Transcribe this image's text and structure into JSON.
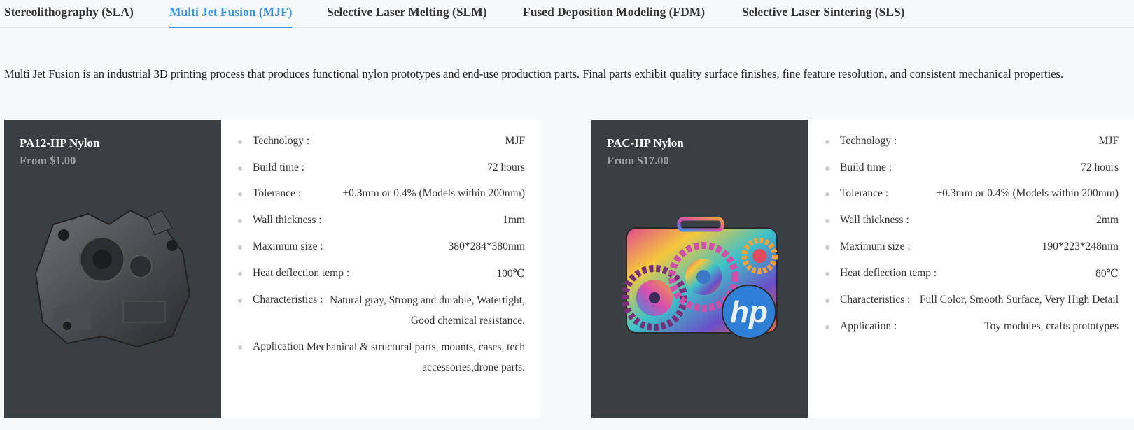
{
  "tabs": [
    {
      "label": "Stereolithography (SLA)",
      "active": false
    },
    {
      "label": "Multi Jet Fusion (MJF)",
      "active": true
    },
    {
      "label": "Selective Laser Melting (SLM)",
      "active": false
    },
    {
      "label": "Fused Deposition Modeling (FDM)",
      "active": false
    },
    {
      "label": "Selective Laser Sintering (SLS)",
      "active": false
    }
  ],
  "description": "Multi Jet Fusion is an industrial 3D printing process that produces functional nylon prototypes and end-use production parts. Final parts exhibit quality surface finishes, fine feature resolution, and consistent mechanical properties.",
  "materials": [
    {
      "name": "PA12-HP Nylon",
      "price": "From $1.00",
      "specs": [
        {
          "label": "Technology :",
          "value": "MJF"
        },
        {
          "label": "Build time :",
          "value": "72 hours"
        },
        {
          "label": "Tolerance :",
          "value": "±0.3mm or 0.4% (Models within 200mm)"
        },
        {
          "label": "Wall thickness :",
          "value": "1mm"
        },
        {
          "label": "Maximum size :",
          "value": "380*284*380mm"
        },
        {
          "label": "Heat deflection temp :",
          "value": "100℃"
        },
        {
          "label": "Characteristics :",
          "value": "Natural gray, Strong and durable, Watertight, Good chemical resistance."
        },
        {
          "label": "Application :",
          "value": "Mechanical & structural parts, mounts, cases, tech accessories,drone parts."
        }
      ]
    },
    {
      "name": "PAC-HP Nylon",
      "price": "From $17.00",
      "specs": [
        {
          "label": "Technology :",
          "value": "MJF"
        },
        {
          "label": "Build time :",
          "value": "72 hours"
        },
        {
          "label": "Tolerance :",
          "value": "±0.3mm or 0.4% (Models within 200mm)"
        },
        {
          "label": "Wall thickness :",
          "value": "2mm"
        },
        {
          "label": "Maximum size :",
          "value": "190*223*248mm"
        },
        {
          "label": "Heat deflection temp :",
          "value": "80℃"
        },
        {
          "label": "Characteristics :",
          "value": "Full Color, Smooth Surface, Very High Detail"
        },
        {
          "label": "Application :",
          "value": "Toy modules, crafts prototypes"
        }
      ]
    }
  ],
  "logo_text": "hp",
  "colors": {
    "accent": "#3a93e6",
    "card_dark": "#3a3f44",
    "price_gray": "#9aa0a6"
  }
}
